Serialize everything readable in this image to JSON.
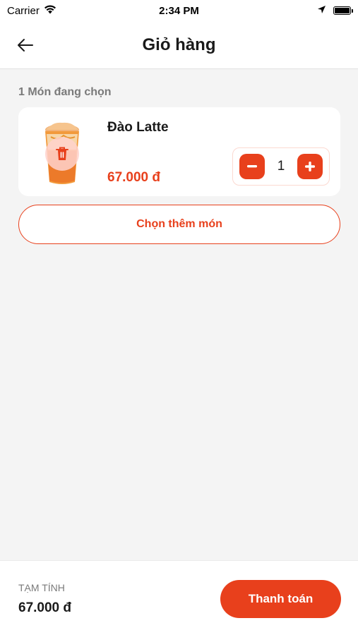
{
  "status_bar": {
    "carrier": "Carrier",
    "time": "2:34 PM"
  },
  "header": {
    "title": "Giỏ hàng"
  },
  "cart": {
    "section_label": "1 Món đang chọn",
    "items": [
      {
        "name": "Đào Latte",
        "price": "67.000 đ",
        "quantity": "1"
      }
    ],
    "add_more_label": "Chọn thêm món"
  },
  "footer": {
    "subtotal_label": "TẠM TÍNH",
    "subtotal_value": "67.000 đ",
    "checkout_label": "Thanh toán"
  },
  "colors": {
    "accent": "#e8401c",
    "background": "#f4f4f4",
    "card": "#ffffff"
  },
  "icons": [
    "wifi-icon",
    "location-arrow-icon",
    "battery-icon",
    "back-arrow-icon",
    "trash-icon",
    "minus-icon",
    "plus-icon"
  ]
}
